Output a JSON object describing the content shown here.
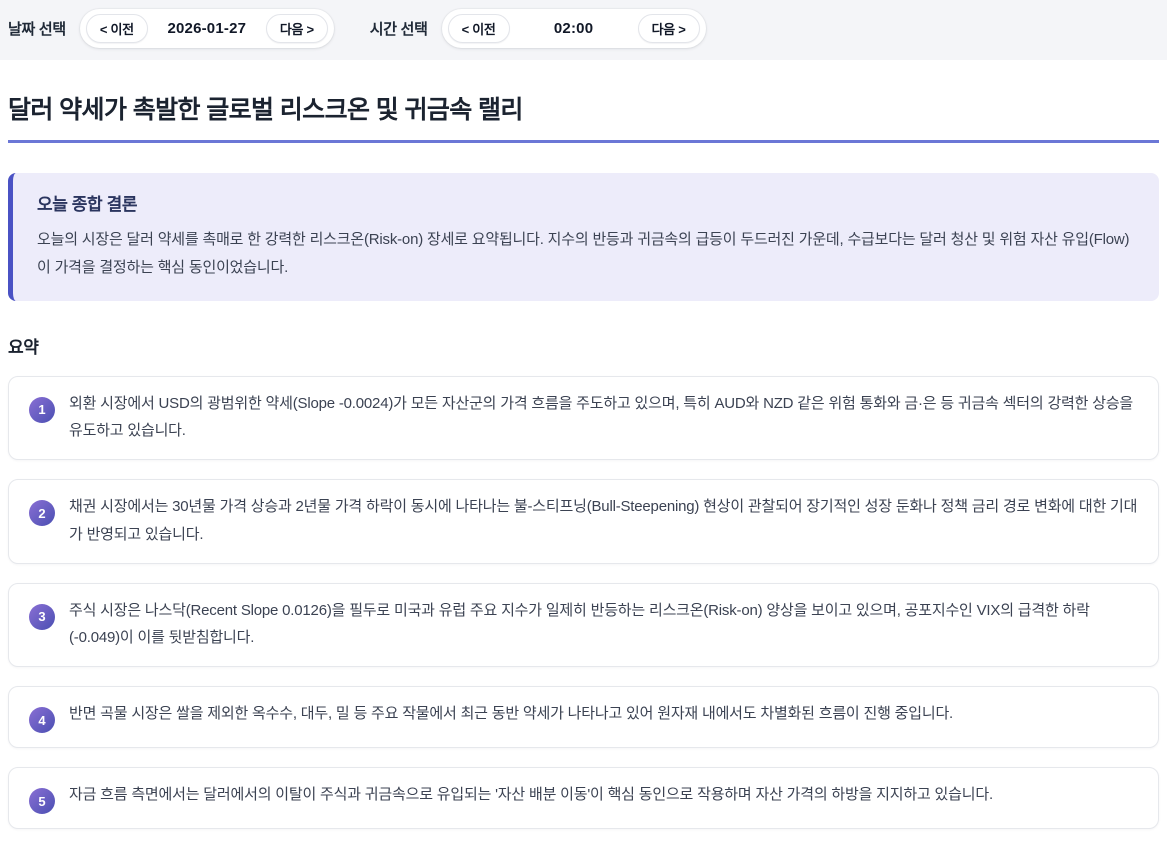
{
  "topbar": {
    "date_label": "날짜 선택",
    "time_label": "시간 선택",
    "prev_label": "< 이전",
    "next_label": "다음 >",
    "date_value": "2026-01-27",
    "time_value": "02:00"
  },
  "page_title": "달러 약세가 촉발한 글로벌 리스크온 및 귀금속 랠리",
  "conclusion": {
    "heading": "오늘 종합 결론",
    "body": "오늘의 시장은 달러 약세를 촉매로 한 강력한 리스크온(Risk-on) 장세로 요약됩니다. 지수의 반등과 귀금속의 급등이 두드러진 가운데, 수급보다는 달러 청산 및 위험 자산 유입(Flow)이 가격을 결정하는 핵심 동인이었습니다."
  },
  "summary": {
    "heading": "요약",
    "items": [
      {
        "number": "1",
        "text": "외환 시장에서 USD의 광범위한 약세(Slope -0.0024)가 모든 자산군의 가격 흐름을 주도하고 있으며, 특히 AUD와 NZD 같은 위험 통화와 금·은 등 귀금속 섹터의 강력한 상승을 유도하고 있습니다."
      },
      {
        "number": "2",
        "text": "채권 시장에서는 30년물 가격 상승과 2년물 가격 하락이 동시에 나타나는 불-스티프닝(Bull-Steepening) 현상이 관찰되어 장기적인 성장 둔화나 정책 금리 경로 변화에 대한 기대가 반영되고 있습니다."
      },
      {
        "number": "3",
        "text": "주식 시장은 나스닥(Recent Slope 0.0126)을 필두로 미국과 유럽 주요 지수가 일제히 반등하는 리스크온(Risk-on) 양상을 보이고 있으며, 공포지수인 VIX의 급격한 하락(-0.049)이 이를 뒷받침합니다."
      },
      {
        "number": "4",
        "text": "반면 곡물 시장은 쌀을 제외한 옥수수, 대두, 밀 등 주요 작물에서 최근 동반 약세가 나타나고 있어 원자재 내에서도 차별화된 흐름이 진행 중입니다."
      },
      {
        "number": "5",
        "text": "자금 흐름 측면에서는 달러에서의 이탈이 주식과 귀금속으로 유입되는 '자산 배분 이동'이 핵심 동인으로 작용하며 자산 가격의 하방을 지지하고 있습니다."
      }
    ]
  },
  "colors": {
    "accent_underline": "#6b77d6",
    "conclusion_bg": "#edecfa",
    "conclusion_border": "#4a52c4",
    "badge_gradient_start": "#8a6fd4",
    "badge_gradient_end": "#4a4fb2",
    "topbar_bg": "#f4f5f8"
  }
}
